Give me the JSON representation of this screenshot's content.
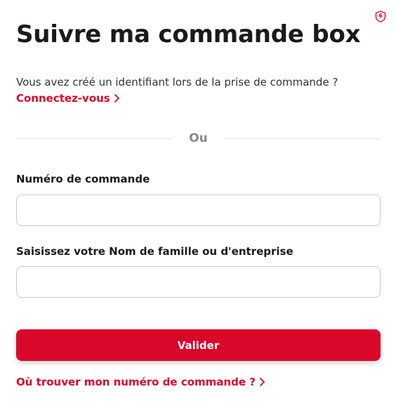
{
  "header": {
    "title": "Suivre ma commande box",
    "badge_count": "6"
  },
  "login": {
    "prompt": "Vous avez créé un identifiant lors de la prise de commande ?",
    "link_label": "Connectez-vous"
  },
  "divider": {
    "label": "Ou"
  },
  "form": {
    "order_number_label": "Numéro de commande",
    "order_number_value": "",
    "name_label": "Saisissez votre Nom de famille ou d'entreprise",
    "name_value": "",
    "submit_label": "Valider"
  },
  "help": {
    "link_label": "Où trouver mon numéro de commande ?"
  },
  "icons": {
    "badge": "shield-badge-icon",
    "chevron": "chevron-right-icon"
  },
  "colors": {
    "accent": "#d9072a",
    "text": "#1a1a1a",
    "muted": "#8a8a8a",
    "border": "#c9c9c9"
  }
}
